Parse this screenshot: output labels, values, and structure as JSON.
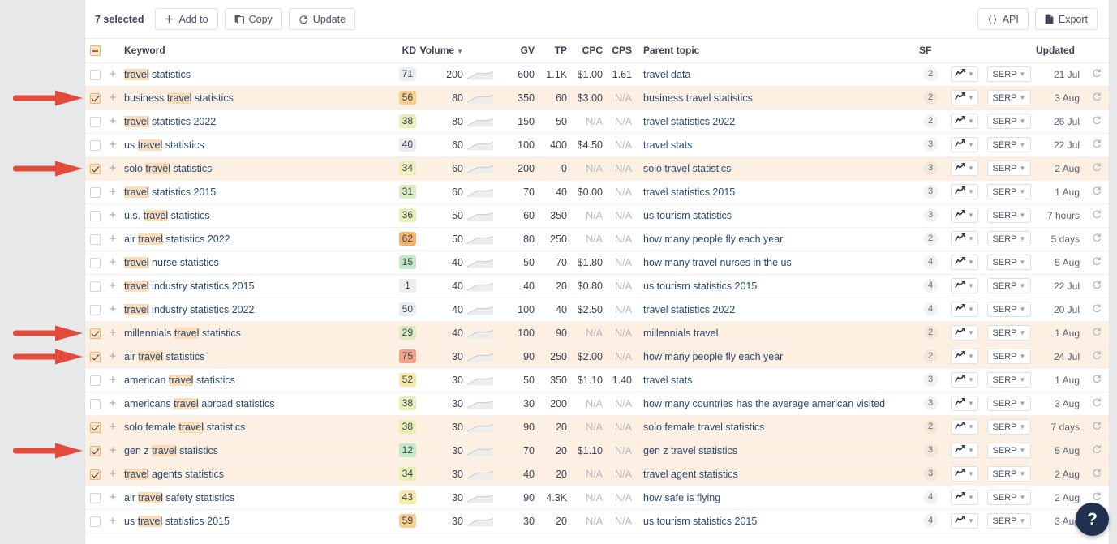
{
  "toolbar": {
    "selected_label": "7 selected",
    "add_to_label": "Add to",
    "copy_label": "Copy",
    "update_label": "Update",
    "api_label": "API",
    "export_label": "Export",
    "add_icon": "plus-icon",
    "copy_icon": "copy-icon",
    "update_icon": "refresh-icon",
    "api_icon": "code-braces-icon",
    "export_icon": "document-icon"
  },
  "columns": {
    "keyword": "Keyword",
    "kd": "KD",
    "volume": "Volume",
    "volume_sort_icon": "sort-desc-caret",
    "gv": "GV",
    "tp": "TP",
    "cpc": "CPC",
    "cps": "CPS",
    "parent_topic": "Parent topic",
    "sf": "SF",
    "updated": "Updated"
  },
  "highlight_term": "travel",
  "row_controls": {
    "trend_icon": "line-chart-icon",
    "trend_caret": "chevron-down-icon",
    "serp_label": "SERP",
    "serp_caret": "chevron-down-icon",
    "refresh_icon": "refresh-icon",
    "add_icon": "plus-icon"
  },
  "kd_colors": {
    "gray": "#ecedef",
    "green": "#c4e7c8",
    "lightgreen": "#dcecc1",
    "yellowgreen": "#e9eeb9",
    "yellow": "#f7e9a8",
    "orange": "#f6cf8e",
    "deeporange": "#f3b26e",
    "red": "#f4a18a"
  },
  "help_button": {
    "label": "?",
    "color": "#20304f"
  },
  "arrow_color": "#e24b3c",
  "arrow_rows": [
    1,
    4,
    11,
    12,
    16
  ],
  "rows": [
    {
      "selected": false,
      "keyword": "travel statistics",
      "kd": "71",
      "kd_color": "gray",
      "volume": "200",
      "gv": "600",
      "tp": "1.1K",
      "cpc": "$1.00",
      "cps": "1.61",
      "parent_topic": "travel data",
      "sf": "2",
      "updated": "21 Jul"
    },
    {
      "selected": true,
      "keyword": "business travel statistics",
      "kd": "56",
      "kd_color": "orange",
      "volume": "80",
      "gv": "350",
      "tp": "60",
      "cpc": "$3.00",
      "cps": "N/A",
      "parent_topic": "business travel statistics",
      "sf": "2",
      "updated": "3 Aug"
    },
    {
      "selected": false,
      "keyword": "travel statistics 2022",
      "kd": "38",
      "kd_color": "yellowgreen",
      "volume": "80",
      "gv": "150",
      "tp": "50",
      "cpc": "N/A",
      "cps": "N/A",
      "parent_topic": "travel statistics 2022",
      "sf": "2",
      "updated": "26 Jul"
    },
    {
      "selected": false,
      "keyword": "us travel statistics",
      "kd": "40",
      "kd_color": "gray",
      "volume": "60",
      "gv": "100",
      "tp": "400",
      "cpc": "$4.50",
      "cps": "N/A",
      "parent_topic": "travel stats",
      "sf": "3",
      "updated": "22 Jul"
    },
    {
      "selected": true,
      "keyword": "solo travel statistics",
      "kd": "34",
      "kd_color": "yellowgreen",
      "volume": "60",
      "gv": "200",
      "tp": "0",
      "cpc": "N/A",
      "cps": "N/A",
      "parent_topic": "solo travel statistics",
      "sf": "3",
      "updated": "2 Aug"
    },
    {
      "selected": false,
      "keyword": "travel statistics 2015",
      "kd": "31",
      "kd_color": "lightgreen",
      "volume": "60",
      "gv": "70",
      "tp": "40",
      "cpc": "$0.00",
      "cps": "N/A",
      "parent_topic": "travel statistics 2015",
      "sf": "3",
      "updated": "1 Aug"
    },
    {
      "selected": false,
      "keyword": "u.s. travel statistics",
      "kd": "36",
      "kd_color": "yellowgreen",
      "volume": "50",
      "gv": "60",
      "tp": "350",
      "cpc": "N/A",
      "cps": "N/A",
      "parent_topic": "us tourism statistics",
      "sf": "3",
      "updated": "7 hours"
    },
    {
      "selected": false,
      "keyword": "air travel statistics 2022",
      "kd": "62",
      "kd_color": "deeporange",
      "volume": "50",
      "gv": "80",
      "tp": "250",
      "cpc": "N/A",
      "cps": "N/A",
      "parent_topic": "how many people fly each year",
      "sf": "2",
      "updated": "5 days"
    },
    {
      "selected": false,
      "keyword": "travel nurse statistics",
      "kd": "15",
      "kd_color": "green",
      "volume": "40",
      "gv": "50",
      "tp": "70",
      "cpc": "$1.80",
      "cps": "N/A",
      "parent_topic": "how many travel nurses in the us",
      "sf": "4",
      "updated": "5 Aug"
    },
    {
      "selected": false,
      "keyword": "travel industry statistics 2015",
      "kd": "1",
      "kd_color": "gray",
      "volume": "40",
      "gv": "40",
      "tp": "20",
      "cpc": "$0.80",
      "cps": "N/A",
      "parent_topic": "us tourism statistics 2015",
      "sf": "4",
      "updated": "22 Jul"
    },
    {
      "selected": false,
      "keyword": "travel industry statistics 2022",
      "kd": "50",
      "kd_color": "gray",
      "volume": "40",
      "gv": "100",
      "tp": "40",
      "cpc": "$2.50",
      "cps": "N/A",
      "parent_topic": "travel statistics 2022",
      "sf": "4",
      "updated": "20 Jul"
    },
    {
      "selected": true,
      "keyword": "millennials travel statistics",
      "kd": "29",
      "kd_color": "lightgreen",
      "volume": "40",
      "gv": "100",
      "tp": "90",
      "cpc": "N/A",
      "cps": "N/A",
      "parent_topic": "millennials travel",
      "sf": "2",
      "updated": "1 Aug"
    },
    {
      "selected": true,
      "keyword": "air travel statistics",
      "kd": "75",
      "kd_color": "red",
      "volume": "30",
      "gv": "90",
      "tp": "250",
      "cpc": "$2.00",
      "cps": "N/A",
      "parent_topic": "how many people fly each year",
      "sf": "2",
      "updated": "24 Jul"
    },
    {
      "selected": false,
      "keyword": "american travel statistics",
      "kd": "52",
      "kd_color": "yellow",
      "volume": "30",
      "gv": "50",
      "tp": "350",
      "cpc": "$1.10",
      "cps": "1.40",
      "parent_topic": "travel stats",
      "sf": "3",
      "updated": "1 Aug"
    },
    {
      "selected": false,
      "keyword": "americans travel abroad statistics",
      "kd": "38",
      "kd_color": "yellowgreen",
      "volume": "30",
      "gv": "30",
      "tp": "200",
      "cpc": "N/A",
      "cps": "N/A",
      "parent_topic": "how many countries has the average american visited",
      "sf": "3",
      "updated": "3 Aug"
    },
    {
      "selected": true,
      "keyword": "solo female travel statistics",
      "kd": "38",
      "kd_color": "yellowgreen",
      "volume": "30",
      "gv": "90",
      "tp": "20",
      "cpc": "N/A",
      "cps": "N/A",
      "parent_topic": "solo female travel statistics",
      "sf": "2",
      "updated": "7 days"
    },
    {
      "selected": true,
      "keyword": "gen z travel statistics",
      "kd": "12",
      "kd_color": "green",
      "volume": "30",
      "gv": "70",
      "tp": "20",
      "cpc": "$1.10",
      "cps": "N/A",
      "parent_topic": "gen z travel statistics",
      "sf": "3",
      "updated": "5 Aug"
    },
    {
      "selected": true,
      "keyword": "travel agents statistics",
      "kd": "34",
      "kd_color": "yellowgreen",
      "volume": "30",
      "gv": "40",
      "tp": "20",
      "cpc": "N/A",
      "cps": "N/A",
      "parent_topic": "travel agent statistics",
      "sf": "3",
      "updated": "2 Aug"
    },
    {
      "selected": false,
      "keyword": "air travel safety statistics",
      "kd": "43",
      "kd_color": "yellow",
      "volume": "30",
      "gv": "90",
      "tp": "4.3K",
      "cpc": "N/A",
      "cps": "N/A",
      "parent_topic": "how safe is flying",
      "sf": "4",
      "updated": "2 Aug"
    },
    {
      "selected": false,
      "keyword": "us travel statistics 2015",
      "kd": "59",
      "kd_color": "orange",
      "volume": "30",
      "gv": "30",
      "tp": "20",
      "cpc": "N/A",
      "cps": "N/A",
      "parent_topic": "us tourism statistics 2015",
      "sf": "4",
      "updated": "3 Aug"
    }
  ]
}
